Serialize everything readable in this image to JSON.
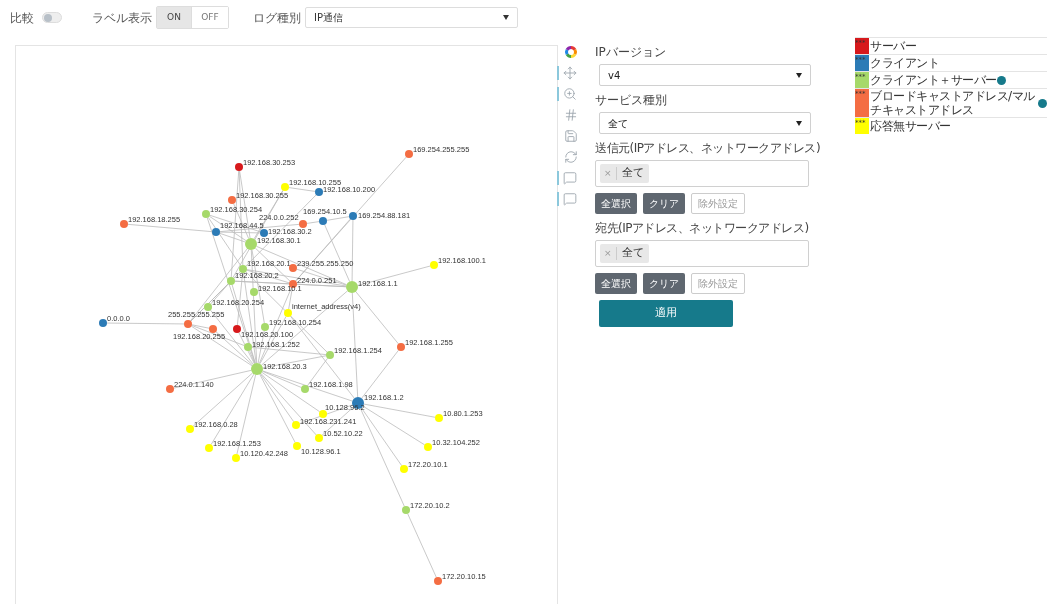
{
  "toolbar": {
    "compare": {
      "label": "比較",
      "on": false
    },
    "label_display": {
      "label": "ラベル表示",
      "options": [
        {
          "label": "ON",
          "selected": true
        },
        {
          "label": "OFF",
          "selected": false
        }
      ]
    },
    "log_type": {
      "label": "ログ種別",
      "value": "IP通信"
    }
  },
  "graph": {
    "nodes": [
      {
        "label": "192.168.30.253",
        "color": "#d7191c"
      },
      {
        "label": "169.254.255.255",
        "color": "#f46d43"
      },
      {
        "label": "192.168.10.255",
        "color": "#ffff00"
      },
      {
        "label": "192.168.10.200",
        "color": "#2c7bb6"
      },
      {
        "label": "192.168.30.255",
        "color": "#f46d43"
      },
      {
        "label": "192.168.30.254",
        "color": "#a6d96a"
      },
      {
        "label": "192.168.18.255",
        "color": "#f46d43"
      },
      {
        "label": "192.168.44.5",
        "color": "#2c7bb6"
      },
      {
        "label": "224.0.0.252",
        "color": "#f46d43"
      },
      {
        "label": "192.168.30.2",
        "color": "#2c7bb6"
      },
      {
        "label": "169.254.10.5",
        "color": "#2c7bb6"
      },
      {
        "label": "169.254.88.181",
        "color": "#2c7bb6"
      },
      {
        "label": "192.168.30.1",
        "color": "#a6d96a"
      },
      {
        "label": "192.168.20.1",
        "color": "#a6d96a"
      },
      {
        "label": "239.255.255.250",
        "color": "#f46d43"
      },
      {
        "label": "192.168.20.2",
        "color": "#a6d96a"
      },
      {
        "label": "224.0.0.251",
        "color": "#f46d43"
      },
      {
        "label": "192.168.1.1",
        "color": "#a6d96a"
      },
      {
        "label": "192.168.10.1",
        "color": "#a6d96a"
      },
      {
        "label": "192.168.100.1",
        "color": "#ffff00"
      },
      {
        "label": "192.168.20.254",
        "color": "#a6d96a"
      },
      {
        "label": "internet_address(v4)",
        "color": "#ffff00"
      },
      {
        "label": "0.0.0.0",
        "color": "#2c7bb6"
      },
      {
        "label": "255.255.255.255",
        "color": "#f46d43"
      },
      {
        "label": "192.168.20.255",
        "color": "#f46d43"
      },
      {
        "label": "192.168.20.100",
        "color": "#d7191c"
      },
      {
        "label": "192.168.10.254",
        "color": "#a6d96a"
      },
      {
        "label": "192.168.1.252",
        "color": "#a6d96a"
      },
      {
        "label": "192.168.1.254",
        "color": "#a6d96a"
      },
      {
        "label": "192.168.1.255",
        "color": "#f46d43"
      },
      {
        "label": "192.168.20.3",
        "color": "#a6d96a"
      },
      {
        "label": "224.0.1.140",
        "color": "#f46d43"
      },
      {
        "label": "192.168.1.98",
        "color": "#a6d96a"
      },
      {
        "label": "192.168.1.2",
        "color": "#2c7bb6"
      },
      {
        "label": "10.128.96.2",
        "color": "#ffff00"
      },
      {
        "label": "192.168.231.241",
        "color": "#ffff00"
      },
      {
        "label": "10.80.1.253",
        "color": "#ffff00"
      },
      {
        "label": "192.168.0.28",
        "color": "#ffff00"
      },
      {
        "label": "10.52.10.22",
        "color": "#ffff00"
      },
      {
        "label": "10.128.96.1",
        "color": "#ffff00"
      },
      {
        "label": "192.168.1.253",
        "color": "#ffff00"
      },
      {
        "label": "10.32.104.252",
        "color": "#ffff00"
      },
      {
        "label": "10.120.42.248",
        "color": "#ffff00"
      },
      {
        "label": "172.20.10.1",
        "color": "#ffff00"
      },
      {
        "label": "172.20.10.2",
        "color": "#a6d96a"
      },
      {
        "label": "172.20.10.15",
        "color": "#f46d43"
      }
    ]
  },
  "filters": {
    "ip_version": {
      "label": "IPバージョン",
      "value": "v4"
    },
    "service_type": {
      "label": "サービス種別",
      "value": "全て"
    },
    "source": {
      "label": "送信元(IPアドレス、ネットワークアドレス)",
      "remove": "×",
      "tag": "全て",
      "buttons": [
        "全選択",
        "クリア",
        "除外設定"
      ]
    },
    "destination": {
      "label": "宛先(IPアドレス、ネットワークアドレス)",
      "remove": "×",
      "tag": "全て",
      "buttons": [
        "全選択",
        "クリア",
        "除外設定"
      ]
    },
    "apply": "適用"
  },
  "legend": [
    {
      "mark": "***",
      "label": "サーバー",
      "color": "#d7191c",
      "info": false
    },
    {
      "mark": "***",
      "label": "クライアント",
      "color": "#2c7bb6",
      "info": false
    },
    {
      "mark": "***",
      "label": "クライアント＋サーバー",
      "color": "#a6d96a",
      "info": true
    },
    {
      "mark": "***",
      "label": "ブロードキャストアドレス/マルチキャストアドレス",
      "color": "#f46d43",
      "info": true
    },
    {
      "mark": "***",
      "label": "応答無サーバー",
      "color": "#ffff00",
      "info": false
    }
  ]
}
